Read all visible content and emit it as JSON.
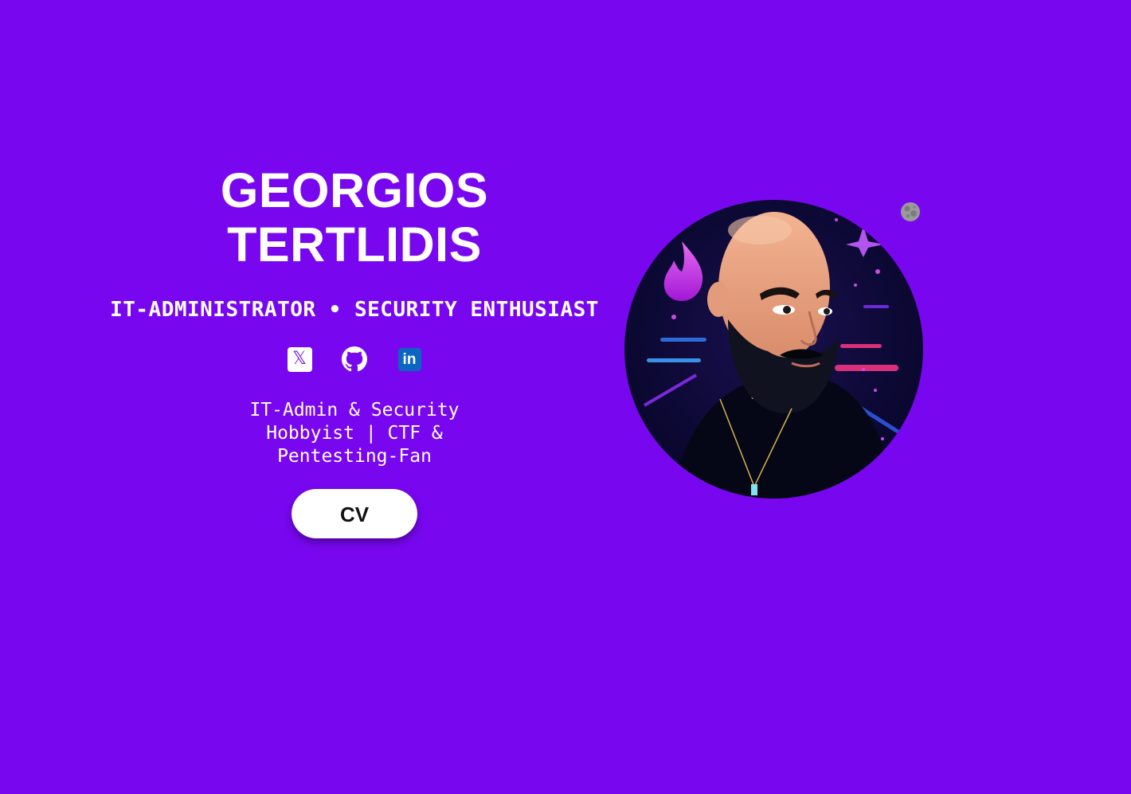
{
  "profile": {
    "first_name": "GEORGIOS",
    "last_name": "TERTLIDIS",
    "tagline": "IT-ADMINISTRATOR • SECURITY ENTHUSIAST",
    "bio": "IT-Admin & Security Hobbyist | CTF & Pentesting-Fan",
    "cv_label": "CV"
  },
  "socials": [
    {
      "icon": "x-icon",
      "glyph": "𝕏"
    },
    {
      "icon": "github-icon"
    },
    {
      "icon": "linkedin-icon",
      "glyph": "in"
    }
  ],
  "theme_toggle": {
    "icon": "moon-icon"
  },
  "colors": {
    "background": "#7807f0",
    "text": "#ffffff",
    "button_bg": "#ffffff",
    "button_text": "#111111",
    "linkedin": "#0a66c2"
  }
}
